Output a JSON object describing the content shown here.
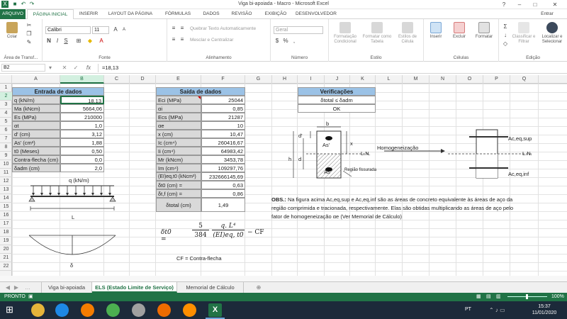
{
  "window": {
    "title": "Viga bi-apoiada - Macro - Microsoft Excel",
    "user": "Entrar",
    "help": "?"
  },
  "ribbon_tabs": [
    "ARQUIVO",
    "PÁGINA INICIAL",
    "INSERIR",
    "LAYOUT DA PÁGINA",
    "FÓRMULAS",
    "DADOS",
    "REVISÃO",
    "EXIBIÇÃO",
    "DESENVOLVEDOR"
  ],
  "ribbon": {
    "paste": "Colar",
    "clipboard": "Área de Transf...",
    "font_name": "Calibri",
    "font_size": "11",
    "font_group": "Fonte",
    "wrap_text": "Quebrar Texto Automaticamente",
    "merge": "Mesclar e Centralizar",
    "alignment_group": "Alinhamento",
    "number_format": "Geral",
    "number_group": "Número",
    "cond_format": "Formatação Condicional",
    "format_table": "Formatar como Tabela",
    "cell_styles": "Estilos de Célula",
    "styles_group": "Estilo",
    "insert": "Inserir",
    "delete": "Excluir",
    "format": "Formatar",
    "cells_group": "Células",
    "sort": "Classificar e Filtrar",
    "find": "Localizar e Selecionar",
    "editing_group": "Edição"
  },
  "formula_bar": {
    "name_box": "B2",
    "formula": "=18,13",
    "fx": "fx"
  },
  "columns": [
    "A",
    "B",
    "C",
    "D",
    "E",
    "F",
    "G",
    "H",
    "I",
    "J",
    "K",
    "L",
    "M",
    "N",
    "O",
    "P",
    "Q"
  ],
  "rows": [
    "1",
    "2",
    "3",
    "4",
    "5",
    "6",
    "7",
    "8",
    "9",
    "10",
    "11",
    "12",
    "13",
    "14",
    "15",
    "16",
    "17",
    "18",
    "19",
    "20",
    "21",
    "22"
  ],
  "entrada": {
    "title": "Entrada de dados",
    "rows": [
      {
        "label": "q (kN/m)",
        "value": "18,13"
      },
      {
        "label": "Ma (kNcm)",
        "value": "5664,06"
      },
      {
        "label": "Es (MPa)",
        "value": "210000"
      },
      {
        "label": "αt",
        "value": "1,0"
      },
      {
        "label": "d' (cm)",
        "value": "3,12"
      },
      {
        "label": "As' (cm²)",
        "value": "1,88"
      },
      {
        "label": "t0 (Meses)",
        "value": "0,50"
      },
      {
        "label": "Contra-flecha (cm)",
        "value": "0,0"
      },
      {
        "label": "δadm (cm)",
        "value": "2,0"
      }
    ]
  },
  "saida": {
    "title": "Saída de dados",
    "rows": [
      {
        "label": "Eci (MPa)",
        "value": "25044"
      },
      {
        "label": "αi",
        "value": "0,85"
      },
      {
        "label": "Ecs (MPa)",
        "value": "21287"
      },
      {
        "label": "αe",
        "value": "10"
      },
      {
        "label": "x (cm)",
        "value": "10,47"
      },
      {
        "label": "Ic (cm⁴)",
        "value": "260416,67"
      },
      {
        "label": "Ii (cm⁴)",
        "value": "64983,42"
      },
      {
        "label": "Mr (kNcm)",
        "value": "3453,78"
      },
      {
        "label": "Im (cm⁴)",
        "value": "109297,76"
      },
      {
        "label": "(EI)eq,t0 (kNcm²)",
        "value": "232666145,69"
      },
      {
        "label": "δt0 (cm) =",
        "value": "0,63"
      },
      {
        "label": "δt,f (cm) =",
        "value": "0,86"
      }
    ],
    "total_label": "δtotal (cm)",
    "total_value": "1,49"
  },
  "verificacoes": {
    "title": "Verificações",
    "condition": "δtotal ≤ δadm",
    "result": "OK"
  },
  "beam": {
    "load": "q (kN/m)",
    "span": "L",
    "deflection": "δ"
  },
  "formula": {
    "lhs": "δt0 =",
    "num1": "5",
    "den1": "384",
    "num2": "q. L⁴",
    "den2": "(EI)eq, t0",
    "tail": "− CF",
    "note": "CF = Contra-flecha"
  },
  "section": {
    "b": "b",
    "d_prime": "d'",
    "as_prime": "As'",
    "x": "x",
    "h": "h",
    "d": "d",
    "ln": "L.N.",
    "as": "As",
    "cracked": "Região fissurada",
    "homog": "Homogeneização",
    "acsup": "Ac,eq,sup",
    "acinf": "Ac,eq,inf",
    "ln2": "L.N."
  },
  "obs": {
    "bold": "OBS.:",
    "lines": [
      "Na figura acima Ac,eq,sup e Ac,eq,inf são as áreas de concreto equivalente às áreas de aço da",
      "região comprimida e tracionada, respectivamente. Elas são obtidas multiplicando as áreas de aço pelo",
      "fator de homogeneização αe (Ver Memorial de Cálculo)"
    ]
  },
  "sheets": [
    "Viga bi-apoiada",
    "ELS (Estado Limite de Serviço)",
    "Memorial de Cálculo"
  ],
  "status": {
    "ready": "PRONTO",
    "zoom": "100%"
  },
  "taskbar": {
    "lang": "PT",
    "time": "15:37",
    "date": "11/01/2020"
  }
}
